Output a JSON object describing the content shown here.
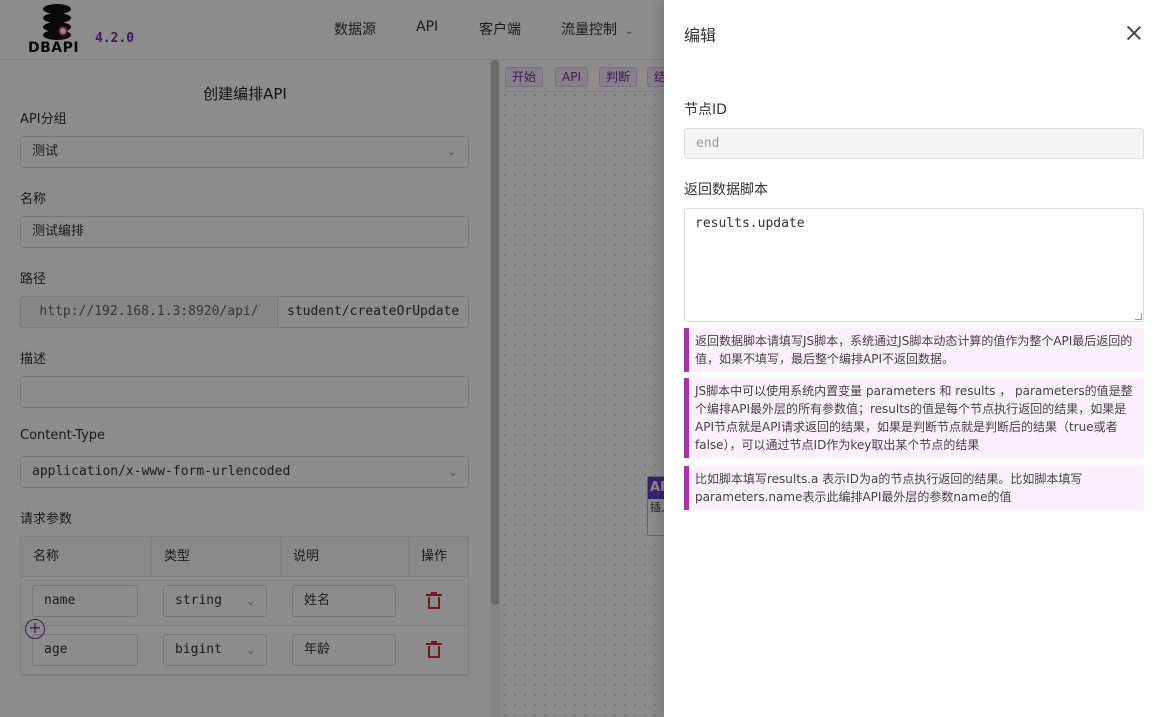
{
  "app": {
    "brand": "DBAPI",
    "version": "4.2.0"
  },
  "nav": {
    "items": [
      "数据源",
      "API",
      "客户端",
      "流量控制"
    ]
  },
  "form": {
    "title": "创建编排API",
    "group_label": "API分组",
    "group_value": "测试",
    "name_label": "名称",
    "name_value": "测试编排",
    "path_label": "路径",
    "path_prefix": "http://192.168.1.3:8920/api/",
    "path_value": "student/createOrUpdate",
    "desc_label": "描述",
    "desc_value": "",
    "content_type_label": "Content-Type",
    "content_type_value": "application/x-www-form-urlencoded",
    "params_label": "请求参数",
    "params_columns": [
      "名称",
      "类型",
      "说明",
      "操作"
    ],
    "params": [
      {
        "name": "name",
        "type": "string",
        "desc": "姓名"
      },
      {
        "name": "age",
        "type": "bigint",
        "desc": "年龄"
      }
    ],
    "add_icon": "plus-circle-icon"
  },
  "canvas": {
    "tools": [
      "开始",
      "API",
      "判断",
      "结"
    ],
    "node_head": "AP",
    "node_sub": "插入"
  },
  "drawer": {
    "title": "编辑",
    "node_id_label": "节点ID",
    "node_id_value": "end",
    "script_label": "返回数据脚本",
    "script_value": "results.update",
    "notes": [
      "返回数据脚本请填写JS脚本，系统通过JS脚本动态计算的值作为整个API最后返回的值，如果不填写，最后整个编排API不返回数据。",
      "JS脚本中可以使用系统内置变量 parameters 和 results ， parameters的值是整个编排API最外层的所有参数值；results的值是每个节点执行返回的结果，如果是API节点就是API请求返回的结果，如果是判断节点就是判断后的结果（true或者false），可以通过节点ID作为key取出某个节点的结果",
      "比如脚本填写results.a 表示ID为a的节点执行返回的结果。比如脚本填写parameters.name表示此编排API最外层的参数name的值"
    ]
  },
  "colors": {
    "accent": "#7a2fa0",
    "danger": "#d03030",
    "note_bg": "#fcf0fc",
    "note_border": "#a832a8"
  }
}
